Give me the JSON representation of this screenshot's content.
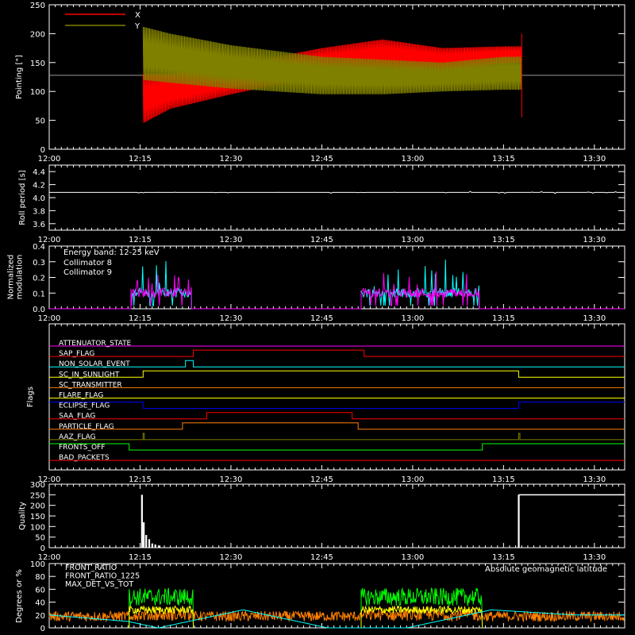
{
  "time_axis": {
    "start_minutes": 720,
    "end_minutes": 815,
    "tick_minutes": [
      720,
      735,
      750,
      765,
      780,
      795,
      810
    ],
    "tick_labels": [
      "12:00",
      "12:15",
      "12:30",
      "12:45",
      "13:00",
      "13:15",
      "13:30"
    ]
  },
  "chart_data": [
    {
      "type": "line",
      "panel": "pointing",
      "ylabel": "Pointing [\"]",
      "ylim": [
        0,
        250
      ],
      "yticks": [
        0,
        50,
        100,
        150,
        200,
        250
      ],
      "baseline": 128,
      "series": [
        {
          "name": "X",
          "color": "#ff0000",
          "envelope": [
            {
              "t": 735.5,
              "lo": 45,
              "hi": 130
            },
            {
              "t": 740,
              "lo": 70,
              "hi": 130
            },
            {
              "t": 750,
              "lo": 95,
              "hi": 145
            },
            {
              "t": 765,
              "lo": 128,
              "hi": 175
            },
            {
              "t": 775,
              "lo": 140,
              "hi": 190
            },
            {
              "t": 785,
              "lo": 135,
              "hi": 175
            },
            {
              "t": 795,
              "lo": 148,
              "hi": 178
            },
            {
              "t": 798,
              "lo": 150,
              "hi": 178
            }
          ]
        },
        {
          "name": "Y",
          "color": "#808000",
          "envelope": [
            {
              "t": 735.5,
              "lo": 120,
              "hi": 212
            },
            {
              "t": 740,
              "lo": 115,
              "hi": 200
            },
            {
              "t": 750,
              "lo": 105,
              "hi": 180
            },
            {
              "t": 765,
              "lo": 95,
              "hi": 160
            },
            {
              "t": 775,
              "lo": 95,
              "hi": 155
            },
            {
              "t": 785,
              "lo": 100,
              "hi": 150
            },
            {
              "t": 795,
              "lo": 103,
              "hi": 160
            },
            {
              "t": 798,
              "lo": 103,
              "hi": 160
            }
          ]
        }
      ]
    },
    {
      "type": "line",
      "panel": "roll",
      "ylabel": "Roll period [s]",
      "ylim": [
        3.5,
        4.5
      ],
      "yticks": [
        3.6,
        3.8,
        4.0,
        4.2,
        4.4
      ],
      "series": [
        {
          "name": "",
          "color": "#ffffff",
          "t_range": [
            720,
            815
          ],
          "value": 4.08
        }
      ]
    },
    {
      "type": "line",
      "panel": "modulation",
      "ylabel": "Normalized modulation",
      "ylim": [
        0,
        0.4
      ],
      "yticks": [
        0.0,
        0.1,
        0.2,
        0.3,
        0.4
      ],
      "annotation": "Energy band: 12-25 keV",
      "series": [
        {
          "name": "Collimator 8",
          "color": "#00ffff",
          "segments": [
            [
              733.5,
              743.5
            ],
            [
              771.5,
              791
            ]
          ],
          "level": 0.09,
          "peak": 0.33
        },
        {
          "name": "Collimator 9",
          "color": "#ff00ff",
          "segments": [
            [
              733.5,
              743.5
            ],
            [
              771.5,
              791
            ]
          ],
          "level": 0.09,
          "peak": 0.24
        }
      ]
    },
    {
      "type": "line",
      "panel": "flags",
      "ylabel": "Flags",
      "series": [
        {
          "name": "ATTENUATOR_STATE",
          "color": "#ff00ff",
          "transitions": [
            [
              720,
              0
            ]
          ]
        },
        {
          "name": "SAP_FLAG",
          "color": "#ff0000",
          "transitions": [
            [
              720,
              0
            ],
            [
              743.8,
              1
            ],
            [
              772,
              0
            ]
          ]
        },
        {
          "name": "NON_SOLAR_EVENT",
          "color": "#00ffff",
          "transitions": [
            [
              720,
              0
            ],
            [
              742.5,
              1
            ],
            [
              743.8,
              0
            ]
          ]
        },
        {
          "name": "SC_IN_SUNLIGHT",
          "color": "#ffff00",
          "transitions": [
            [
              720,
              0
            ],
            [
              735.5,
              1
            ],
            [
              797.5,
              0
            ]
          ]
        },
        {
          "name": "SC_TRANSMITTER",
          "color": "#ff8000",
          "transitions": [
            [
              720,
              0
            ]
          ]
        },
        {
          "name": "FLARE_FLAG",
          "color": "#ffff00",
          "transitions": [
            [
              720,
              0
            ]
          ]
        },
        {
          "name": "ECLIPSE_FLAG",
          "color": "#0000ff",
          "transitions": [
            [
              720,
              1
            ],
            [
              735.5,
              0
            ],
            [
              797.5,
              1
            ]
          ]
        },
        {
          "name": "SAA_FLAG",
          "color": "#ff0000",
          "transitions": [
            [
              720,
              0
            ],
            [
              746,
              1
            ],
            [
              770,
              0
            ]
          ]
        },
        {
          "name": "PARTICLE_FLAG",
          "color": "#ff8000",
          "transitions": [
            [
              720,
              0
            ],
            [
              742,
              1
            ],
            [
              771,
              0
            ]
          ]
        },
        {
          "name": "AAZ_FLAG",
          "color": "#808000",
          "transitions": [
            [
              720,
              0
            ],
            [
              735.5,
              1
            ],
            [
              735.7,
              0
            ],
            [
              797.5,
              1
            ],
            [
              797.7,
              0
            ]
          ]
        },
        {
          "name": "FRONTS_OFF",
          "color": "#00ff00",
          "transitions": [
            [
              720,
              1
            ],
            [
              733.2,
              0
            ],
            [
              791.5,
              1
            ]
          ]
        },
        {
          "name": "BAD_PACKETS",
          "color": "#ff0000",
          "transitions": [
            [
              720,
              0
            ]
          ]
        }
      ]
    },
    {
      "type": "bar",
      "panel": "quality",
      "ylabel": "Quality",
      "ylim": [
        0,
        300
      ],
      "yticks": [
        0,
        50,
        100,
        150,
        200,
        250,
        300
      ],
      "series": [
        {
          "name": "",
          "color": "#ffffff",
          "points": [
            {
              "t": 735.3,
              "v": 250
            },
            {
              "t": 735.6,
              "v": 120
            },
            {
              "t": 736,
              "v": 60
            },
            {
              "t": 736.5,
              "v": 40
            },
            {
              "t": 737,
              "v": 20
            },
            {
              "t": 737.5,
              "v": 15
            },
            {
              "t": 738.2,
              "v": 10
            },
            {
              "t": 797.5,
              "v": 250
            }
          ],
          "high_segment": {
            "from": 797.5,
            "to": 815,
            "v": 250
          }
        }
      ]
    },
    {
      "type": "line",
      "panel": "ratios",
      "ylabel": "Degrees or %",
      "ylim": [
        0,
        100
      ],
      "yticks": [
        0,
        20,
        40,
        60,
        80,
        100
      ],
      "annotation": "Absolute geomagnetic latitude",
      "series": [
        {
          "name": "FRONT_RATIO",
          "color": "#ffff00",
          "segments": [
            [
              733.2,
              743.8
            ],
            [
              771.5,
              791.5
            ]
          ],
          "mean": 28
        },
        {
          "name": "FRONT_RATIO_1225",
          "color": "#00ff00",
          "segments": [
            [
              733.2,
              743.8
            ],
            [
              771.5,
              791.5
            ]
          ],
          "mean": 48
        },
        {
          "name": "MAX_DET_VS_TOT",
          "color": "#ff8000",
          "segments": [
            [
              720,
              815
            ]
          ],
          "mean": 18
        },
        {
          "name": "Absolute geomagnetic latitude",
          "color": "#00ffff",
          "curve": [
            {
              "t": 720,
              "v": 20
            },
            {
              "t": 733,
              "v": 10
            },
            {
              "t": 738,
              "v": 0
            },
            {
              "t": 752,
              "v": 28
            },
            {
              "t": 766,
              "v": 0
            },
            {
              "t": 779,
              "v": 0
            },
            {
              "t": 793,
              "v": 28
            },
            {
              "t": 807,
              "v": 20
            },
            {
              "t": 815,
              "v": 20
            }
          ]
        }
      ]
    }
  ]
}
